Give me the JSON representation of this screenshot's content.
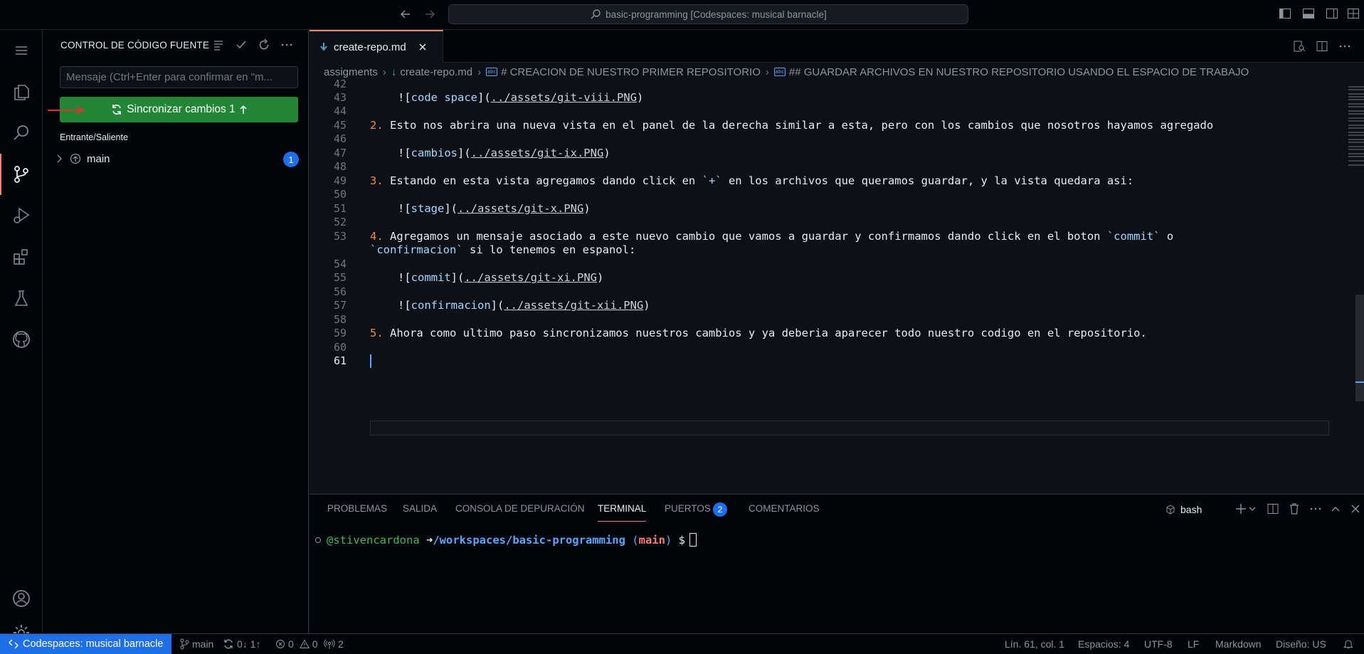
{
  "window": {
    "command_center": "basic-programming [Codespaces: musical barnacle]"
  },
  "sidebar": {
    "title": "CONTROL DE CÓDIGO FUENTE",
    "commit_placeholder": "Mensaje (Ctrl+Enter para confirmar en \"m...",
    "sync_label": "Sincronizar cambios 1",
    "incoming_outgoing": "Entrante/Saliente",
    "branch": "main",
    "branch_count": "1"
  },
  "editor": {
    "tab_label": "create-repo.md",
    "breadcrumbs": [
      "assigments",
      "create-repo.md",
      "# CREACION DE NUESTRO PRIMER REPOSITORIO",
      "## GUARDAR ARCHIVOS EN NUESTRO REPOSITORIO USANDO EL ESPACIO DE TRABAJO"
    ],
    "lines": {
      "l42": "42",
      "l43": "43",
      "l44": "44",
      "l45": "45",
      "l46": "46",
      "l47": "47",
      "l48": "48",
      "l49": "49",
      "l50": "50",
      "l51": "51",
      "l52": "52",
      "l53": "53",
      "l54": "54",
      "l55": "55",
      "l56": "56",
      "l57": "57",
      "l58": "58",
      "l59": "59",
      "l60": "60",
      "l61": "61"
    },
    "code": {
      "c43_alt": "code space",
      "c43_url": "../assets/git-viii.PNG",
      "c45_num": "2.",
      "c45_text": " Esto nos abrira una nueva vista en el panel de la derecha similar a esta, pero con los cambios que nosotros hayamos agregado",
      "c47_alt": "cambios",
      "c47_url": "../assets/git-ix.PNG",
      "c49_num": "3.",
      "c49_a": " Estando en esta vista agregamos dando click en ",
      "c49_code": "`+`",
      "c49_b": " en los archivos que queramos guardar, y la vista quedara asi:",
      "c51_alt": "stage",
      "c51_url": "../assets/git-x.PNG",
      "c53_num": "4.",
      "c53_a": " Agregamos un mensaje asociado a este nuevo cambio que vamos a guardar y confirmamos dando click en el boton ",
      "c53_code": "`commit`",
      "c53_b": " o",
      "c53w_code": "`confirmacion`",
      "c53w_b": " si lo tenemos en espanol:",
      "c55_alt": "commit",
      "c55_url": "../assets/git-xi.PNG",
      "c57_alt": "confirmacion",
      "c57_url": "../assets/git-xii.PNG",
      "c59_num": "5.",
      "c59_text": " Ahora como ultimo paso sincronizamos nuestros cambios y ya deberia aparecer todo nuestro codigo en el repositorio."
    }
  },
  "panel": {
    "tabs": [
      "PROBLEMAS",
      "SALIDA",
      "CONSOLA DE DEPURACIÓN",
      "TERMINAL",
      "PUERTOS",
      "COMENTARIOS"
    ],
    "ports_count": "2",
    "shell": "bash",
    "terminal": {
      "user": "@stivencardona",
      "arrow": "➜",
      "path": "/workspaces/basic-programming",
      "branch": "main",
      "prompt": "$"
    }
  },
  "statusbar": {
    "remote": "Codespaces: musical barnacle",
    "branch": "main",
    "sync": "0↓ 1↑",
    "errors": "0",
    "warnings": "0",
    "ports": "2",
    "position": "Lín. 61, col. 1",
    "spaces": "Espacios: 4",
    "encoding": "UTF-8",
    "eol": "LF",
    "language": "Markdown",
    "layout": "Diseño: US"
  },
  "colors": {
    "accent": "#f78166",
    "sync_button": "#238636",
    "badge": "#1f6feb",
    "link": "#a5d6ff",
    "list_number": "#f0883e"
  }
}
